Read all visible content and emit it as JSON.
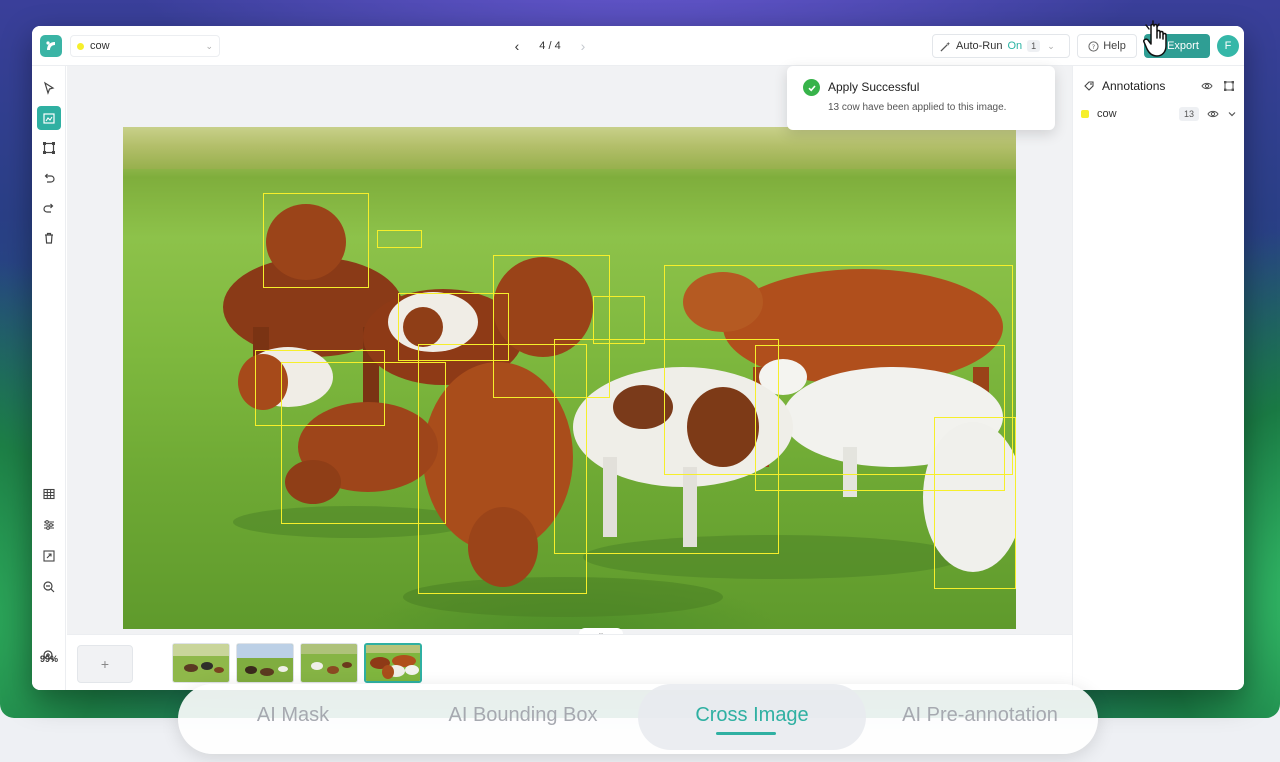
{
  "topbar": {
    "label_select": {
      "value": "cow",
      "color": "#f6ef2b"
    },
    "pager": {
      "text": "4 / 4"
    },
    "auto_run": {
      "label": "Auto-Run",
      "state": "On",
      "count": "1"
    },
    "help_label": "Help",
    "export_label": "Export",
    "avatar_initial": "F"
  },
  "toolbar": {
    "tools": [
      "select-arrow-icon",
      "ai-annotate-icon",
      "bounding-box-icon",
      "undo-icon",
      "redo-icon",
      "delete-icon"
    ],
    "bottom_tools": [
      "grid-icon",
      "sliders-icon",
      "fit-screen-icon",
      "zoom-out-icon",
      "zoom-in-icon"
    ],
    "zoom": "99%"
  },
  "toast": {
    "title": "Apply Successful",
    "message": "13 cow have been applied to this image."
  },
  "panel": {
    "title": "Annotations",
    "items": [
      {
        "label": "cow",
        "count": "13",
        "color": "#f6ef2b"
      }
    ]
  },
  "filmstrip": {
    "add_label": "+",
    "thumbnails": 4,
    "selected_index": 3
  },
  "tabs": [
    {
      "label": "AI Mask",
      "active": false
    },
    {
      "label": "AI Bounding Box",
      "active": false
    },
    {
      "label": "Cross Image",
      "active": true
    },
    {
      "label": "AI Pre-annotation",
      "active": false
    }
  ],
  "colors": {
    "accent": "#2fb0a2",
    "bbox": "#f6ef2b",
    "success": "#37b34a"
  }
}
